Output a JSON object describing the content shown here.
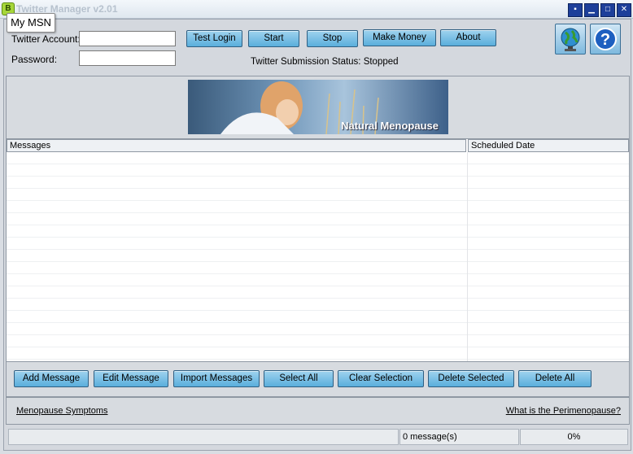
{
  "window": {
    "title": "Twitter Manager v2.01",
    "tooltip": "My MSN",
    "controls": [
      "▪",
      "▁",
      "□",
      "✕"
    ]
  },
  "form": {
    "account_label": "Twitter Account:",
    "password_label": "Password:",
    "account_value": "",
    "password_value": ""
  },
  "toolbar": {
    "test_login": "Test Login",
    "start": "Start",
    "stop": "Stop",
    "make_money": "Make Money",
    "about": "About",
    "status": "Twitter Submission Status: Stopped",
    "icons": [
      "globe-icon",
      "help-icon"
    ]
  },
  "banner": {
    "caption": "Natural Menopause"
  },
  "table": {
    "columns": [
      "Messages",
      "Scheduled Date"
    ],
    "rows": []
  },
  "actions": {
    "add": "Add Message",
    "edit": "Edit Message",
    "import": "Import Messages",
    "select_all": "Select All",
    "clear": "Clear Selection",
    "delete_selected": "Delete Selected",
    "delete_all": "Delete All"
  },
  "links": {
    "left": "Menopause Symptoms",
    "right": "What is the Perimenopause?"
  },
  "statusbar": {
    "count": "0 message(s)",
    "progress": "0%"
  }
}
